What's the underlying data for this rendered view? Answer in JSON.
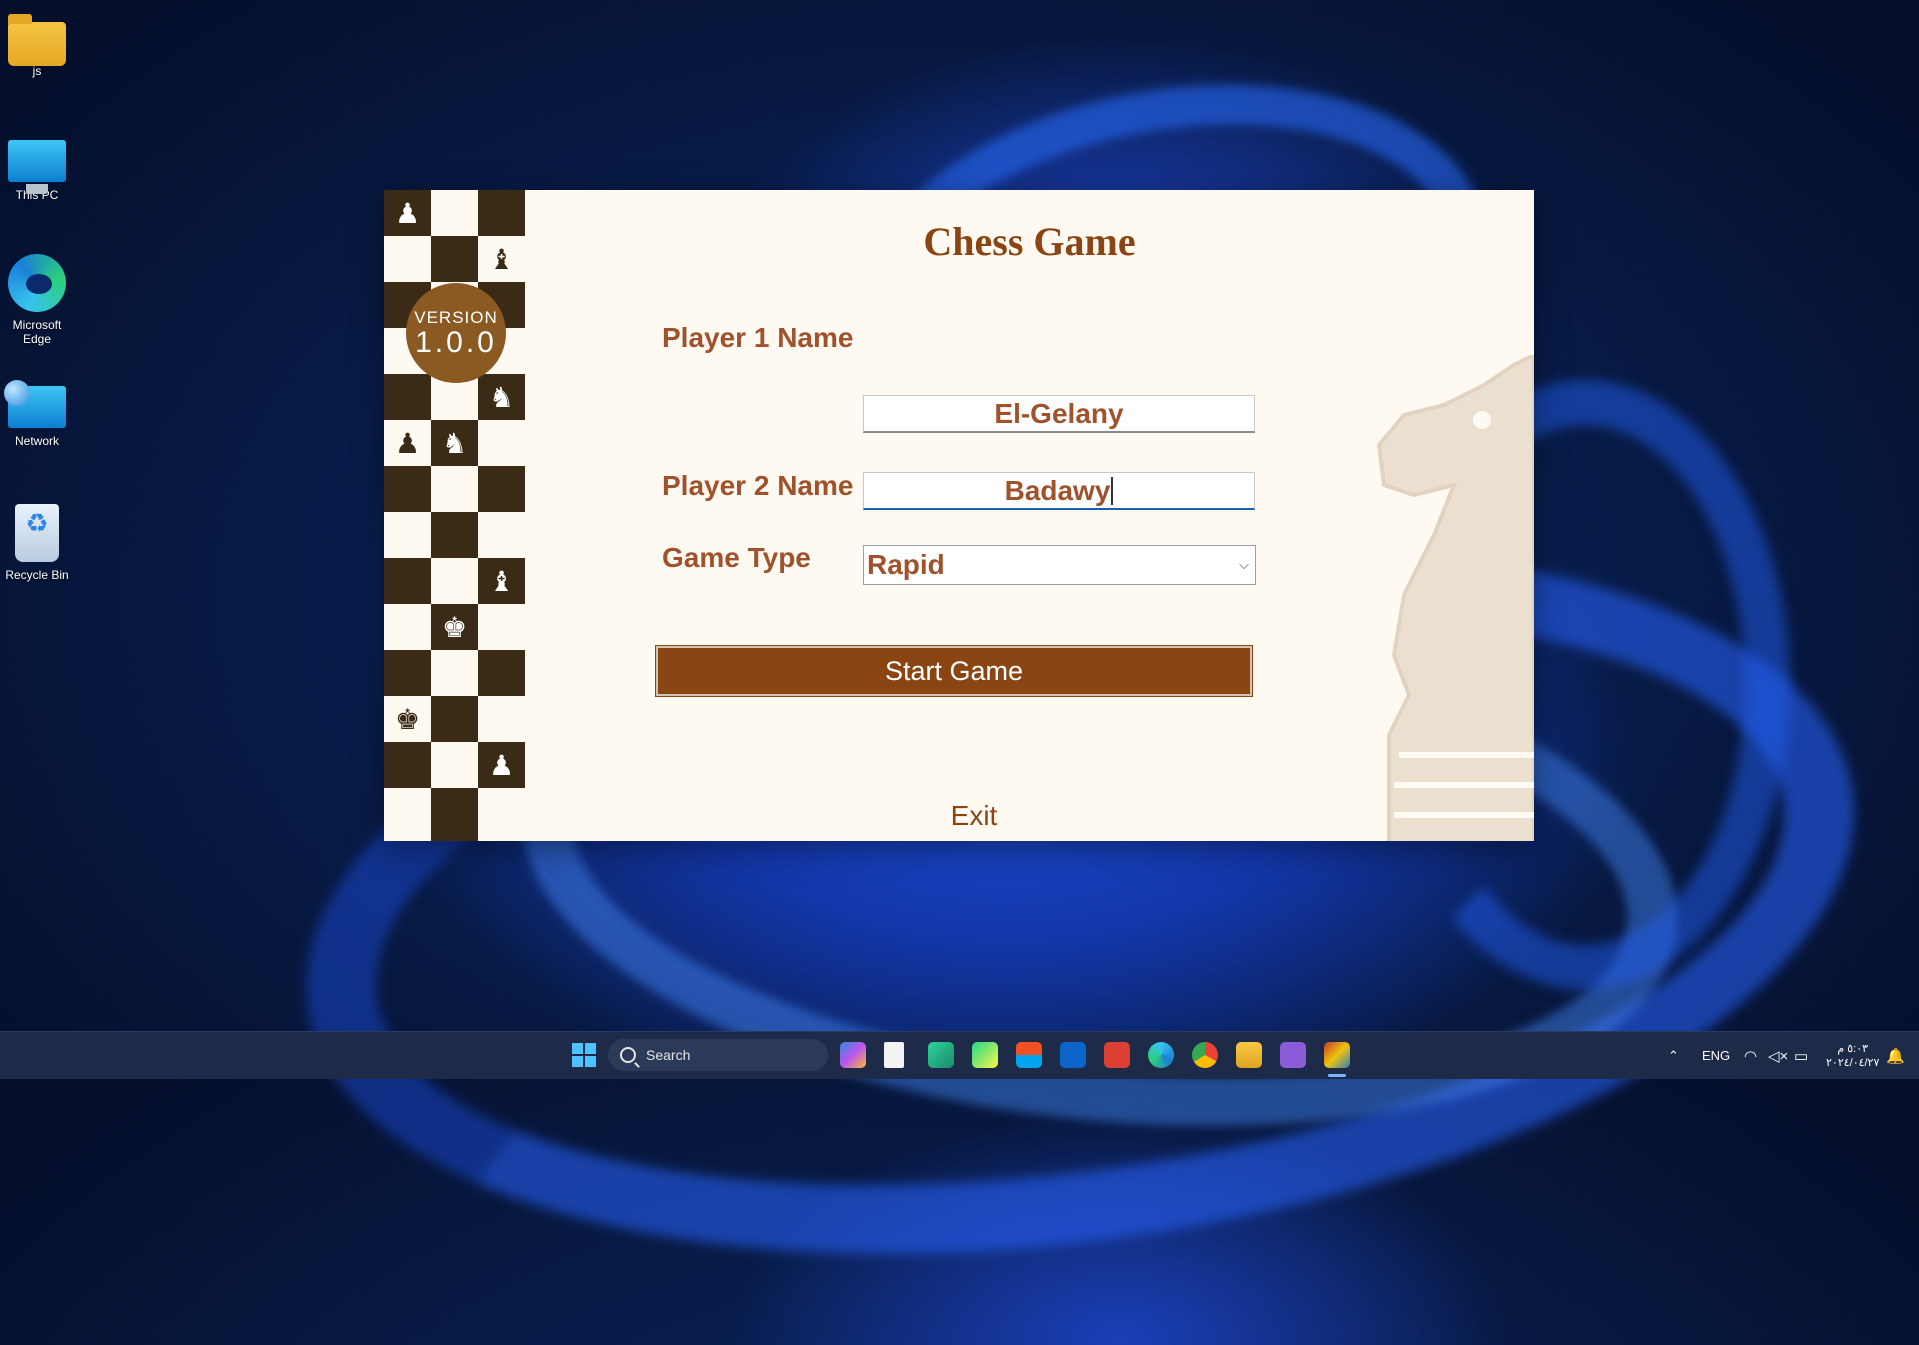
{
  "desktop": {
    "icons": [
      {
        "label": "js",
        "icon": "folder-icon"
      },
      {
        "label": "This PC",
        "icon": "computer-icon"
      },
      {
        "label": "Microsoft Edge",
        "icon": "edge-icon"
      },
      {
        "label": "Network",
        "icon": "network-icon"
      },
      {
        "label": "Recycle Bin",
        "icon": "recycle-bin-icon"
      }
    ]
  },
  "app": {
    "title": "Chess Game",
    "version_label": "VERSION",
    "version_number": "1.0.0",
    "form": {
      "player1_label": "Player 1 Name",
      "player1_value": "El-Gelany",
      "player2_label": "Player 2 Name",
      "player2_value": "Badawy",
      "game_type_label": "Game Type",
      "game_type_value": "Rapid"
    },
    "start_button": "Start Game",
    "exit_link": "Exit",
    "colors": {
      "accent": "#8b4513",
      "label": "#a0522d",
      "dark_square": "#3b2a16",
      "background": "#fffaf1",
      "badge": "#8b5a23"
    }
  },
  "taskbar": {
    "search_placeholder": "Search",
    "apps": [
      "start-icon",
      "copilot-icon",
      "file-icon",
      "clion-icon",
      "pycharm-icon",
      "store-icon",
      "outlook-icon",
      "todoist-icon",
      "edge-icon",
      "chrome-icon",
      "explorer-icon",
      "visual-studio-icon",
      "chess-app-icon"
    ],
    "language": "ENG",
    "time": "٥:٠٣ م",
    "date": "٢٠٢٤/٠٤/٢٧"
  }
}
